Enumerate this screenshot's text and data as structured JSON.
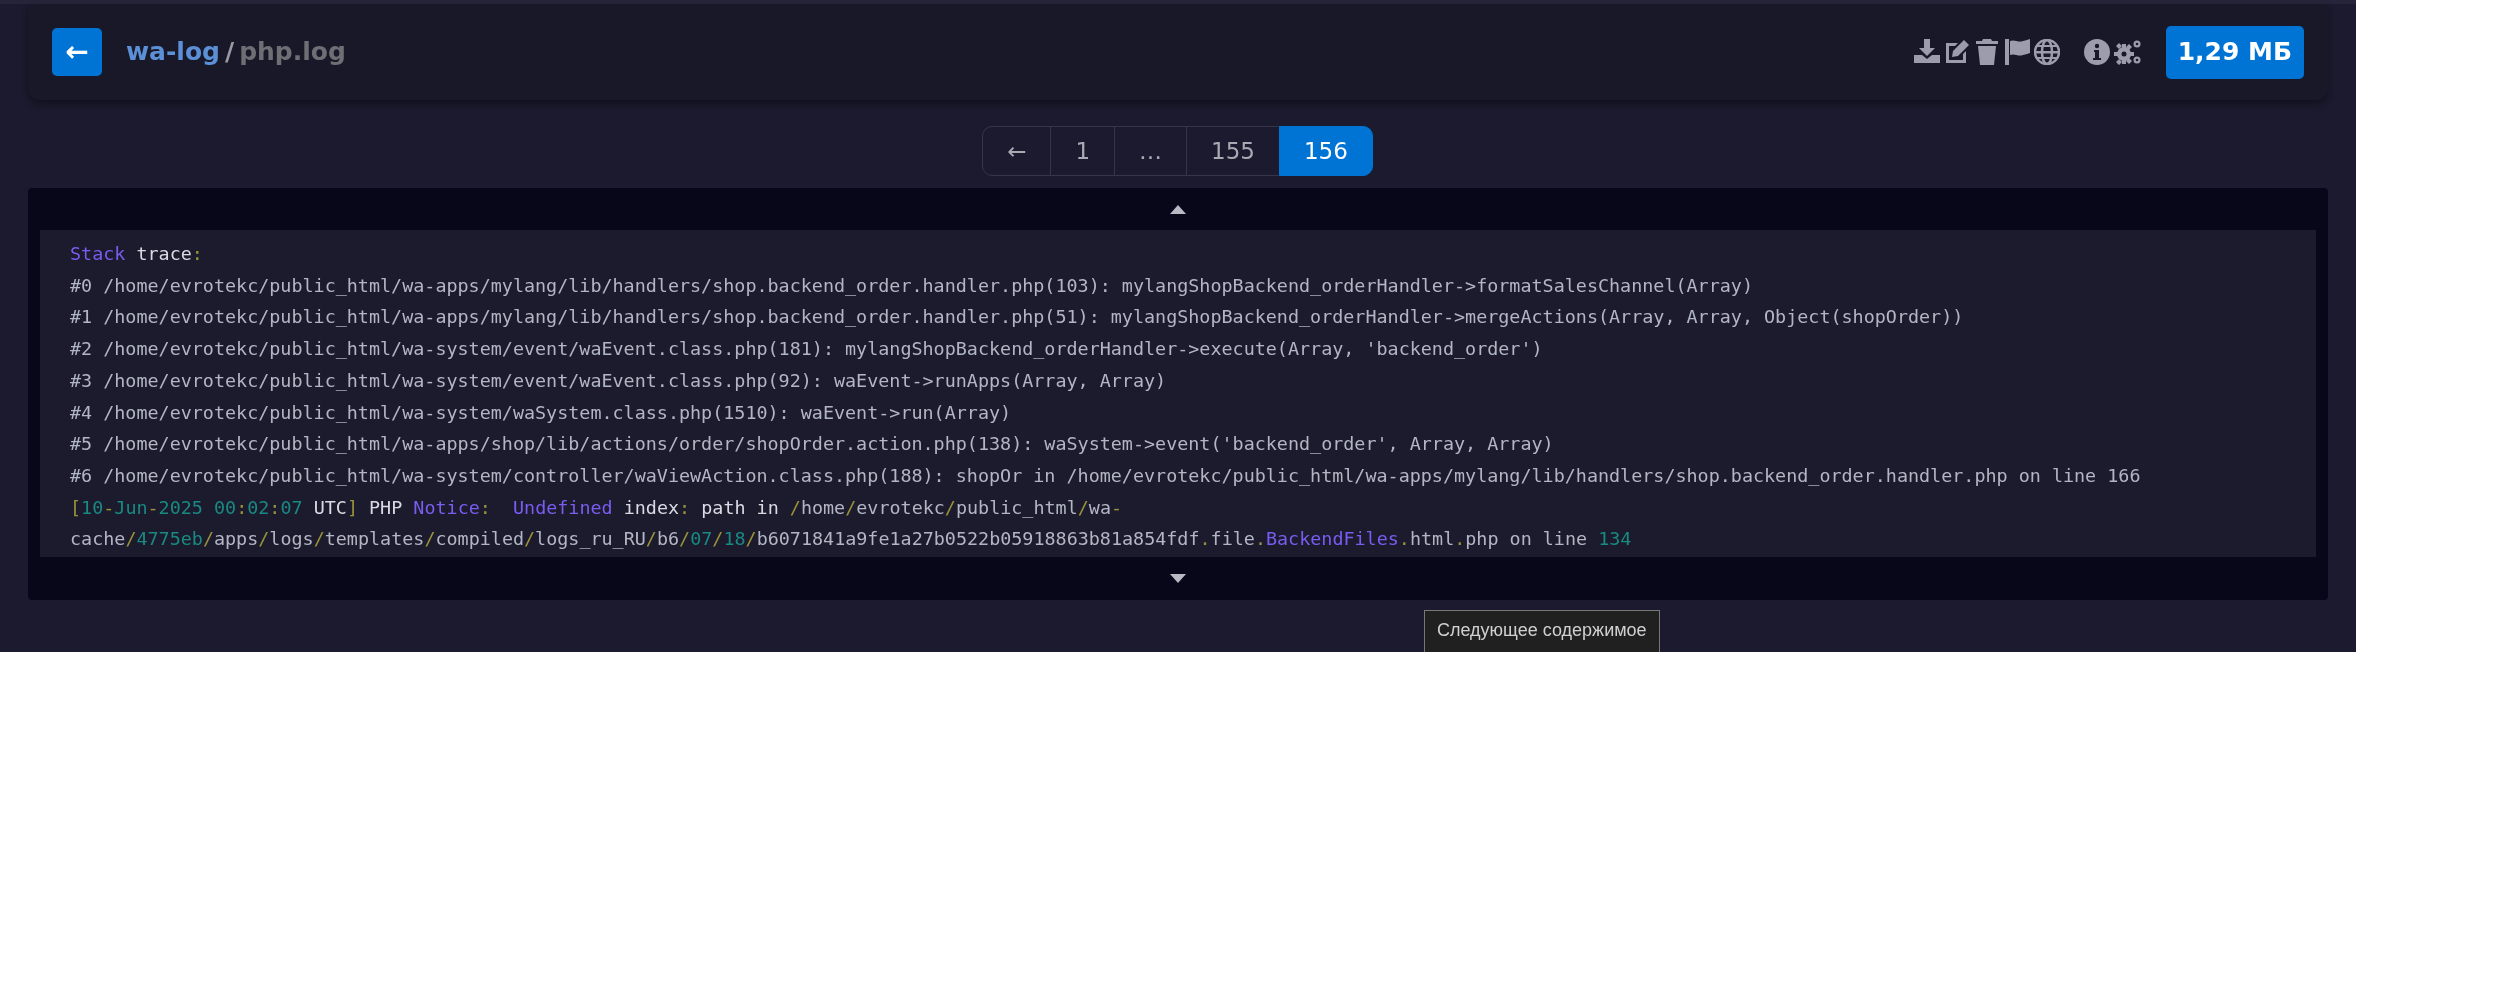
{
  "header": {
    "back_button": "←",
    "breadcrumb": [
      {
        "text": "wa-log",
        "kind": "link"
      },
      {
        "text": "/",
        "kind": "sep"
      },
      {
        "text": "php.log",
        "kind": "current"
      }
    ],
    "size": "1,29 МБ"
  },
  "pagination": [
    {
      "label": "←",
      "selected": false
    },
    {
      "label": "1",
      "selected": false
    },
    {
      "label": "…",
      "selected": false
    },
    {
      "label": "155",
      "selected": false
    },
    {
      "label": "156",
      "selected": true
    }
  ],
  "log_lines": [
    [
      {
        "kind": "kw",
        "text": "Stack"
      },
      {
        "kind": "em",
        "text": " trace"
      },
      {
        "kind": "sep",
        "text": ":"
      }
    ],
    [
      {
        "kind": "text",
        "text": "#0 /home/evrotekc/public_html/wa-apps/mylang/lib/handlers/shop.backend_order.handler.php(103): mylangShopBackend_orderHandler->formatSalesChannel(Array)"
      }
    ],
    [
      {
        "kind": "text",
        "text": "#1 /home/evrotekc/public_html/wa-apps/mylang/lib/handlers/shop.backend_order.handler.php(51): mylangShopBackend_orderHandler->mergeActions(Array, Array, Object(shopOrder))"
      }
    ],
    [
      {
        "kind": "text",
        "text": "#2 /home/evrotekc/public_html/wa-system/event/waEvent.class.php(181): mylangShopBackend_orderHandler->execute(Array, 'backend_order')"
      }
    ],
    [
      {
        "kind": "text",
        "text": "#3 /home/evrotekc/public_html/wa-system/event/waEvent.class.php(92): waEvent->runApps(Array, Array)"
      }
    ],
    [
      {
        "kind": "text",
        "text": "#4 /home/evrotekc/public_html/wa-system/waSystem.class.php(1510): waEvent->run(Array)"
      }
    ],
    [
      {
        "kind": "text",
        "text": "#5 /home/evrotekc/public_html/wa-apps/shop/lib/actions/order/shopOrder.action.php(138): waSystem->event('backend_order', Array, Array)"
      }
    ],
    [
      {
        "kind": "text",
        "text": "#6 /home/evrotekc/public_html/wa-system/controller/waViewAction.class.php(188): shopOr in /home/evrotekc/public_html/wa-apps/mylang/lib/handlers/shop.backend_order.handler.php on line 166"
      }
    ],
    [
      {
        "kind": "sep",
        "text": "["
      },
      {
        "kind": "num",
        "text": "10"
      },
      {
        "kind": "sep",
        "text": "-"
      },
      {
        "kind": "num",
        "text": "Jun"
      },
      {
        "kind": "sep",
        "text": "-"
      },
      {
        "kind": "num",
        "text": "2025"
      },
      {
        "kind": "num",
        "text": " 00"
      },
      {
        "kind": "sep",
        "text": ":"
      },
      {
        "kind": "num",
        "text": "02"
      },
      {
        "kind": "sep",
        "text": ":"
      },
      {
        "kind": "num",
        "text": "07"
      },
      {
        "kind": "em",
        "text": " UTC"
      },
      {
        "kind": "sep",
        "text": "]"
      },
      {
        "kind": "em",
        "text": " PHP "
      },
      {
        "kind": "kw",
        "text": "Notice"
      },
      {
        "kind": "sep",
        "text": ":"
      },
      {
        "kind": "kw",
        "text": "  Undefined"
      },
      {
        "kind": "em",
        "text": " index"
      },
      {
        "kind": "sep",
        "text": ":"
      },
      {
        "kind": "em",
        "text": " path "
      },
      {
        "kind": "em",
        "text": "in "
      },
      {
        "kind": "sep",
        "text": "/"
      },
      {
        "kind": "text",
        "text": "home"
      },
      {
        "kind": "sep",
        "text": "/"
      },
      {
        "kind": "text",
        "text": "evrotekc"
      },
      {
        "kind": "sep",
        "text": "/"
      },
      {
        "kind": "text",
        "text": "public_html"
      },
      {
        "kind": "sep",
        "text": "/"
      },
      {
        "kind": "text",
        "text": "wa"
      },
      {
        "kind": "sep",
        "text": "-"
      }
    ],
    [
      {
        "kind": "text",
        "text": "cache"
      },
      {
        "kind": "sep",
        "text": "/"
      },
      {
        "kind": "num",
        "text": "4775eb"
      },
      {
        "kind": "sep",
        "text": "/"
      },
      {
        "kind": "text",
        "text": "apps"
      },
      {
        "kind": "sep",
        "text": "/"
      },
      {
        "kind": "text",
        "text": "logs"
      },
      {
        "kind": "sep",
        "text": "/"
      },
      {
        "kind": "text",
        "text": "templates"
      },
      {
        "kind": "sep",
        "text": "/"
      },
      {
        "kind": "text",
        "text": "compiled"
      },
      {
        "kind": "sep",
        "text": "/"
      },
      {
        "kind": "text",
        "text": "logs_ru_RU"
      },
      {
        "kind": "sep",
        "text": "/"
      },
      {
        "kind": "text",
        "text": "b6"
      },
      {
        "kind": "sep",
        "text": "/"
      },
      {
        "kind": "num",
        "text": "07"
      },
      {
        "kind": "sep",
        "text": "/"
      },
      {
        "kind": "num",
        "text": "18"
      },
      {
        "kind": "sep",
        "text": "/"
      },
      {
        "kind": "text",
        "text": "b6071841a9fe1a27b0522b05918863b81a854fdf"
      },
      {
        "kind": "sep",
        "text": "."
      },
      {
        "kind": "text",
        "text": "file"
      },
      {
        "kind": "sep",
        "text": "."
      },
      {
        "kind": "kw",
        "text": "BackendFiles"
      },
      {
        "kind": "sep",
        "text": "."
      },
      {
        "kind": "text",
        "text": "html"
      },
      {
        "kind": "sep",
        "text": "."
      },
      {
        "kind": "text",
        "text": "php on line "
      },
      {
        "kind": "num",
        "text": "134"
      }
    ]
  ],
  "tooltip": "Следующее содержимое"
}
